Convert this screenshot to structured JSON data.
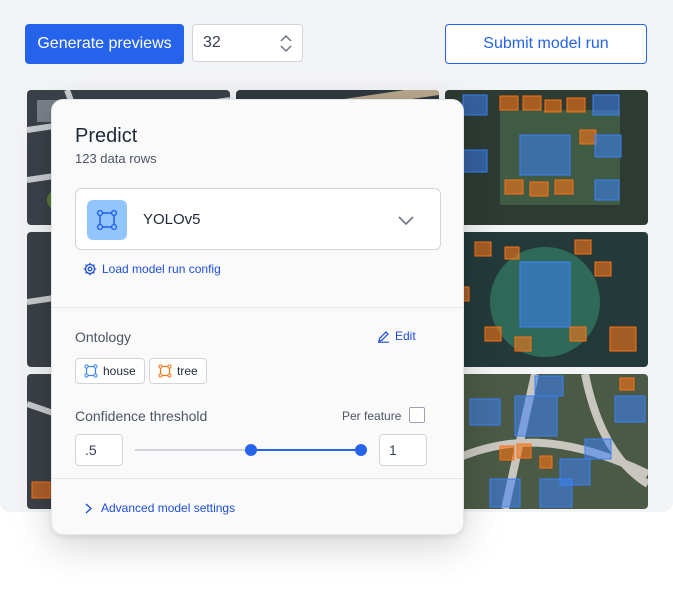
{
  "toolbar": {
    "generate_label": "Generate previews",
    "count_value": "32",
    "submit_label": "Submit model run"
  },
  "predict": {
    "title": "Predict",
    "subtitle": "123 data rows",
    "model_name": "YOLOv5",
    "load_config_label": "Load model run config",
    "ontology_label": "Ontology",
    "edit_label": "Edit",
    "ontology_items": [
      {
        "label": "house",
        "color": "#3b82f6"
      },
      {
        "label": "tree",
        "color": "#f97316"
      }
    ],
    "confidence_label": "Confidence threshold",
    "per_feature_label": "Per feature",
    "conf_min": ".5",
    "conf_max": "1",
    "advanced_label": "Advanced model settings"
  },
  "colors": {
    "accent": "#2563eb",
    "house_box": "#3b82f6",
    "tree_box": "#f97316"
  }
}
